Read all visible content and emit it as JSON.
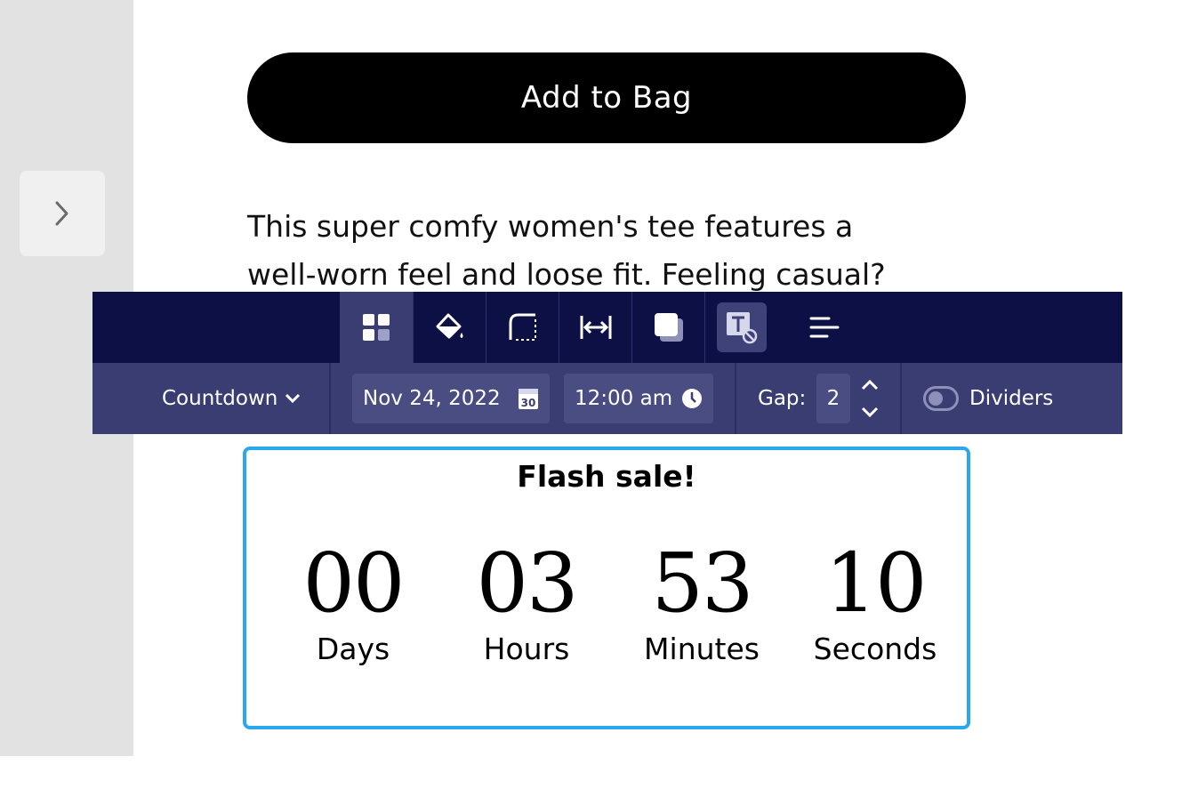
{
  "product": {
    "add_to_bag_label": "Add to Bag",
    "description_line1": "This super comfy women's tee features a",
    "description_line2": "well-worn feel and loose fit. Feeling casual?"
  },
  "toolbar": {
    "tools": [
      "layout-icon",
      "fill-icon",
      "corner-radius-icon",
      "width-icon",
      "shadow-icon",
      "text-style-off-icon",
      "align-icon"
    ],
    "mode_label": "Countdown",
    "date_value": "Nov 24, 2022",
    "calendar_day": "30",
    "time_value": "12:00 am",
    "gap_label": "Gap:",
    "gap_value": "2",
    "dividers_label": "Dividers",
    "dividers_on": false
  },
  "countdown": {
    "title": "Flash sale!",
    "units": [
      {
        "value": "00",
        "label": "Days"
      },
      {
        "value": "03",
        "label": "Hours"
      },
      {
        "value": "53",
        "label": "Minutes"
      },
      {
        "value": "10",
        "label": "Seconds"
      }
    ]
  },
  "colors": {
    "toolbar_dark": "#0c1045",
    "toolbar_light": "#3a3d72",
    "selection_border": "#2aa8ee"
  }
}
